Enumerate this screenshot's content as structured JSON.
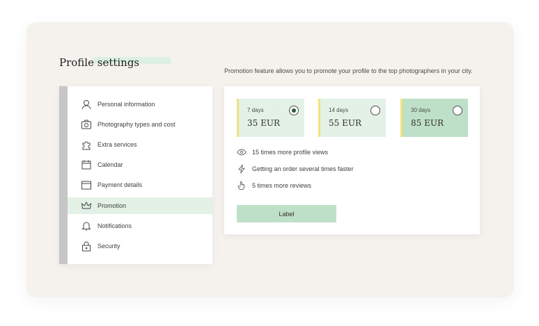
{
  "header": {
    "title": "Profile settings",
    "subtitle": "Promotion feature allows you to promote your profile to the top photographers in your city."
  },
  "sidebar": {
    "items": [
      {
        "label": "Personal information",
        "icon": "user-icon"
      },
      {
        "label": "Photography types and cost",
        "icon": "camera-icon"
      },
      {
        "label": "Extra services",
        "icon": "puzzle-icon"
      },
      {
        "label": "Calendar",
        "icon": "calendar-icon"
      },
      {
        "label": "Payment details",
        "icon": "wallet-icon"
      },
      {
        "label": "Promotion",
        "icon": "crown-icon",
        "active": true
      },
      {
        "label": "Notifications",
        "icon": "bell-icon"
      },
      {
        "label": "Security",
        "icon": "lock-icon"
      }
    ]
  },
  "promotion": {
    "plans": [
      {
        "days": "7 days",
        "price": "35 EUR",
        "selected": true
      },
      {
        "days": "14 days",
        "price": "55 EUR",
        "selected": false
      },
      {
        "days": "30 days",
        "price": "85 EUR",
        "selected": false
      }
    ],
    "benefits": [
      {
        "text": "15 times more profile views",
        "icon": "eye-icon"
      },
      {
        "text": "Getting an order several times faster",
        "icon": "lightning-icon"
      },
      {
        "text": "5 times more reviews",
        "icon": "hand-pointer-icon"
      }
    ],
    "button_label": "Label"
  },
  "colors": {
    "accent_green": "#bfe0c8",
    "light_green": "#e3f1e6",
    "yellow_marker": "#f1e27d",
    "sidebar_bar": "#c6c6c6",
    "background": "#f5f2ee"
  }
}
